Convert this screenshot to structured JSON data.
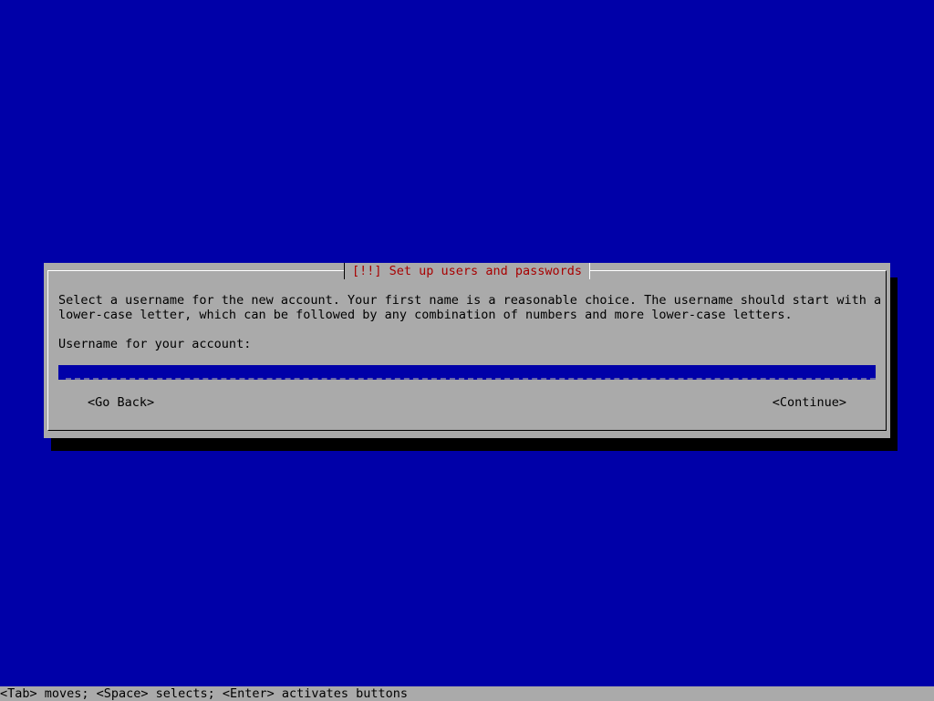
{
  "dialog": {
    "title": "[!!] Set up users and passwords",
    "prompt": "Select a username for the new account. Your first name is a reasonable choice. The username should start with a\nlower-case letter, which can be followed by any combination of numbers and more lower-case letters.",
    "field_label": "Username for your account:",
    "username_value": ""
  },
  "buttons": {
    "go_back": "<Go Back>",
    "continue": "<Continue>"
  },
  "status_bar": {
    "text": "<Tab> moves; <Space> selects; <Enter> activates buttons"
  },
  "colors": {
    "background": "#0000a8",
    "dialog": "#aaaaaa",
    "title": "#a80000",
    "input_bg": "#0000a8",
    "text": "#000000"
  }
}
